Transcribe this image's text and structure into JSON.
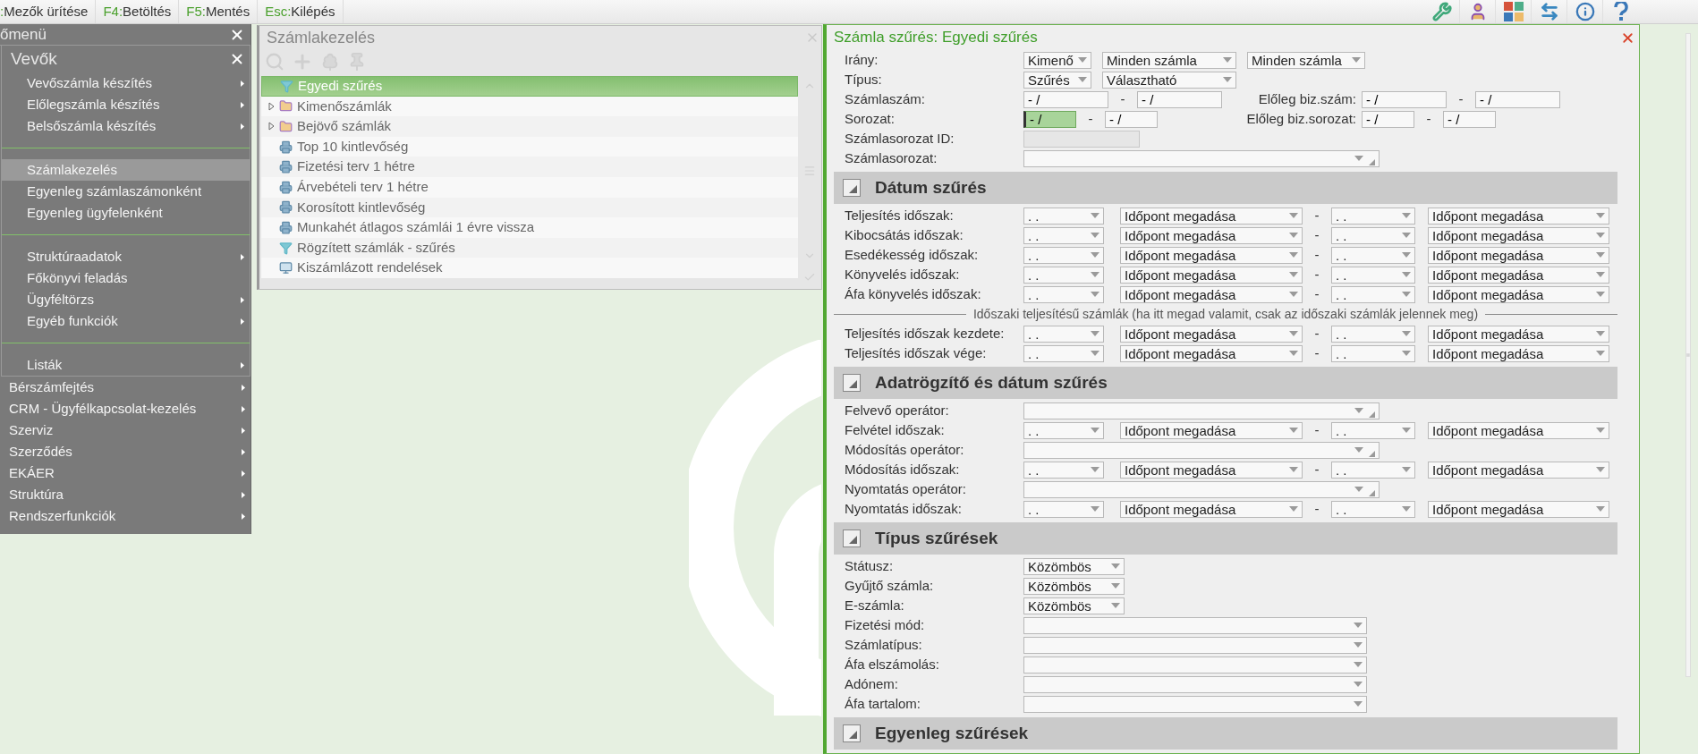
{
  "toolbar": {
    "shortcuts": [
      {
        "key": ":",
        "label": "Mezők ürítése"
      },
      {
        "key": "F4:",
        "label": "Betöltés"
      },
      {
        "key": "F5:",
        "label": "Mentés"
      },
      {
        "key": "Esc:",
        "label": "Kilépés"
      }
    ]
  },
  "main_menu": {
    "title": "őmenü",
    "submenu": {
      "title": "Vevők",
      "groups": [
        [
          {
            "label": "Vevőszámla készítés",
            "has_submenu": true,
            "selected": false
          },
          {
            "label": "Előlegszámla készítés",
            "has_submenu": true,
            "selected": false
          },
          {
            "label": "Belsőszámla készítés",
            "has_submenu": true,
            "selected": false
          }
        ],
        [
          {
            "label": "Számlakezelés",
            "has_submenu": false,
            "selected": true
          },
          {
            "label": "Egyenleg számlaszámonként",
            "has_submenu": false,
            "selected": false
          },
          {
            "label": "Egyenleg ügyfelenként",
            "has_submenu": false,
            "selected": false
          }
        ],
        [
          {
            "label": "Struktúraadatok",
            "has_submenu": true,
            "selected": false
          },
          {
            "label": "Főkönyvi feladás",
            "has_submenu": false,
            "selected": false
          },
          {
            "label": "Ügyféltörzs",
            "has_submenu": true,
            "selected": false
          },
          {
            "label": "Egyéb funkciók",
            "has_submenu": true,
            "selected": false
          }
        ],
        [
          {
            "label": "Listák",
            "has_submenu": true,
            "selected": false
          }
        ]
      ]
    },
    "items": [
      {
        "label": "Bérszámfejtés",
        "has_submenu": true,
        "selected": false
      },
      {
        "label": "CRM - Ügyfélkapcsolat-kezelés",
        "has_submenu": true,
        "selected": false
      },
      {
        "label": "Szerviz",
        "has_submenu": true,
        "selected": false
      },
      {
        "label": "Szerződés",
        "has_submenu": true,
        "selected": false
      },
      {
        "label": "EKÁER",
        "has_submenu": true,
        "selected": false
      },
      {
        "label": "Struktúra",
        "has_submenu": true,
        "selected": false
      },
      {
        "label": "Rendszerfunkciók",
        "has_submenu": true,
        "selected": false
      }
    ]
  },
  "invoice_panel": {
    "title": "Számlakezelés",
    "items": [
      {
        "kind": "filter",
        "label": "Egyedi szűrés",
        "selected": true,
        "expandable": false
      },
      {
        "kind": "folder",
        "label": "Kimenőszámlák",
        "selected": false,
        "expandable": true
      },
      {
        "kind": "folder",
        "label": "Bejövő számlák",
        "selected": false,
        "expandable": true
      },
      {
        "kind": "report",
        "label": "Top 10 kintlevőség",
        "selected": false,
        "expandable": false
      },
      {
        "kind": "report",
        "label": "Fizetési terv 1 hétre",
        "selected": false,
        "expandable": false
      },
      {
        "kind": "report",
        "label": "Árvebételi terv 1 hétre",
        "selected": false,
        "expandable": false
      },
      {
        "kind": "report",
        "label": "Korosított kintlevőség",
        "selected": false,
        "expandable": false
      },
      {
        "kind": "report",
        "label": "Munkahét átlagos számlái 1 évre vissza",
        "selected": false,
        "expandable": false
      },
      {
        "kind": "filter",
        "label": "Rögzített számlák - szűrés",
        "selected": false,
        "expandable": false
      },
      {
        "kind": "screen",
        "label": "Kiszámlázott rendelések",
        "selected": false,
        "expandable": false
      }
    ]
  },
  "filter_panel": {
    "title": "Számla szűrés: Egyedi szűrés",
    "rows": [
      {
        "kind": "selects",
        "label": "Irány:",
        "selects": [
          "Kimenő",
          "Minden számla",
          "Minden számla"
        ]
      },
      {
        "kind": "selects",
        "label": "Típus:",
        "selects": [
          "Szűrés",
          "Választható"
        ]
      },
      {
        "kind": "range",
        "label": "Számlaszám:",
        "from": {
          "value": "- /",
          "focused": false
        },
        "dash": "-",
        "to": {
          "value": "- /",
          "focused": false
        },
        "extra_label": "Előleg biz.szám:",
        "extra_from": {
          "value": "- /",
          "focused": false
        },
        "extra_dash": "-",
        "extra_to": {
          "value": "- /",
          "focused": false
        }
      },
      {
        "kind": "range",
        "label": "Sorozat:",
        "from": {
          "value": "- /",
          "focused": true
        },
        "dash": "-",
        "to": {
          "value": "- /",
          "focused": false
        },
        "extra_label": "Előleg biz.sorozat:",
        "extra_from": {
          "value": "- /",
          "focused": false
        },
        "extra_dash": "-",
        "extra_to": {
          "value": "- /",
          "focused": false
        }
      },
      {
        "kind": "readonly",
        "label": "Számlasorozat ID:"
      },
      {
        "kind": "combo",
        "label": "Számlasorozat:"
      }
    ],
    "sections": [
      {
        "title": "Dátum szűrés",
        "expanded": true,
        "rows": [
          {
            "kind": "date_range",
            "label": "Teljesítés időszak:",
            "from_date": ". .",
            "from_mode": "Időpont megadása",
            "dash": "-",
            "to_date": ". .",
            "to_mode": "Időpont megadása"
          },
          {
            "kind": "date_range",
            "label": "Kibocsátás időszak:",
            "from_date": ". .",
            "from_mode": "Időpont megadása",
            "dash": "-",
            "to_date": ". .",
            "to_mode": "Időpont megadása"
          },
          {
            "kind": "date_range",
            "label": "Esedékesség időszak:",
            "from_date": ". .",
            "from_mode": "Időpont megadása",
            "dash": "-",
            "to_date": ". .",
            "to_mode": "Időpont megadása"
          },
          {
            "kind": "date_range",
            "label": "Könyvelés időszak:",
            "from_date": ". .",
            "from_mode": "Időpont megadása",
            "dash": "-",
            "to_date": ". .",
            "to_mode": "Időpont megadása"
          },
          {
            "kind": "date_range",
            "label": "Áfa könyvelés időszak:",
            "from_date": ". .",
            "from_mode": "Időpont megadása",
            "dash": "-",
            "to_date": ". .",
            "to_mode": "Időpont megadása"
          },
          {
            "kind": "note",
            "text": "Időszaki teljesítésű számlák (ha itt megad valamit, csak az időszaki számlák jelennek meg)"
          },
          {
            "kind": "date_range",
            "label": "Teljesítés időszak kezdete:",
            "from_date": ". .",
            "from_mode": "Időpont megadása",
            "dash": "-",
            "to_date": ". .",
            "to_mode": "Időpont megadása"
          },
          {
            "kind": "date_range",
            "label": "Teljesítés időszak vége:",
            "from_date": ". .",
            "from_mode": "Időpont megadása",
            "dash": "-",
            "to_date": ". .",
            "to_mode": "Időpont megadása"
          }
        ]
      },
      {
        "title": "Adatrögzítő és dátum szűrés",
        "expanded": true,
        "rows": [
          {
            "kind": "combo",
            "label": "Felvevő operátor:"
          },
          {
            "kind": "date_range",
            "label": "Felvétel időszak:",
            "from_date": ". .",
            "from_mode": "Időpont megadása",
            "dash": "-",
            "to_date": ". .",
            "to_mode": "Időpont megadása"
          },
          {
            "kind": "combo",
            "label": "Módosítás operátor:"
          },
          {
            "kind": "date_range",
            "label": "Módosítás időszak:",
            "from_date": ". .",
            "from_mode": "Időpont megadása",
            "dash": "-",
            "to_date": ". .",
            "to_mode": "Időpont megadása"
          },
          {
            "kind": "combo",
            "label": "Nyomtatás operátor:"
          },
          {
            "kind": "date_range",
            "label": "Nyomtatás időszak:",
            "from_date": ". .",
            "from_mode": "Időpont megadása",
            "dash": "-",
            "to_date": ". .",
            "to_mode": "Időpont megadása"
          }
        ]
      },
      {
        "title": "Típus szűrések",
        "expanded": true,
        "rows": [
          {
            "kind": "select",
            "label": "Státusz:",
            "value": "Közömbös"
          },
          {
            "kind": "select",
            "label": "Gyűjtő számla:",
            "value": "Közömbös"
          },
          {
            "kind": "select",
            "label": "E-számla:",
            "value": "Közömbös"
          },
          {
            "kind": "list",
            "label": "Fizetési mód:"
          },
          {
            "kind": "list",
            "label": "Számlatípus:"
          },
          {
            "kind": "list",
            "label": "Áfa elszámolás:"
          },
          {
            "kind": "list",
            "label": "Adónem:"
          },
          {
            "kind": "list",
            "label": "Áfa tartalom:"
          }
        ]
      },
      {
        "title": "Egyenleg szűrések",
        "expanded": true
      }
    ]
  }
}
